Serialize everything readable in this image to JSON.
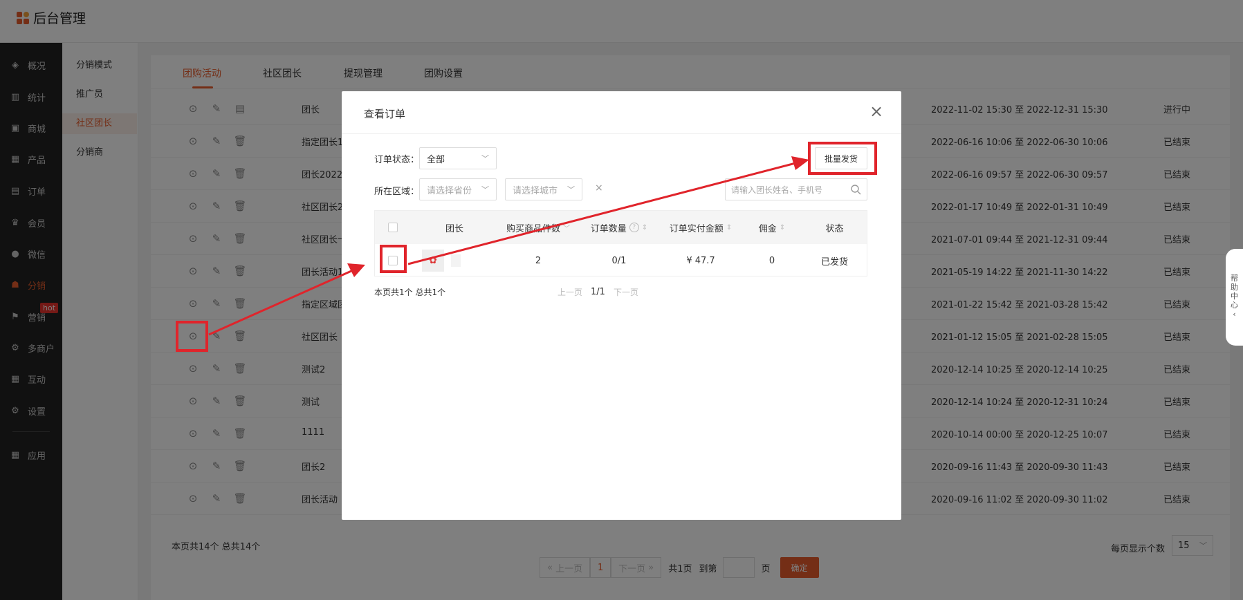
{
  "app": {
    "title": "后台管理"
  },
  "sidebar": {
    "items": [
      {
        "label": "概况",
        "icon": "layers-icon",
        "glyph": "◈"
      },
      {
        "label": "统计",
        "icon": "chart-icon",
        "glyph": "▥"
      },
      {
        "label": "商城",
        "icon": "shop-icon",
        "glyph": "▣"
      },
      {
        "label": "产品",
        "icon": "grid-icon",
        "glyph": "▦"
      },
      {
        "label": "订单",
        "icon": "order-icon",
        "glyph": "▤"
      },
      {
        "label": "会员",
        "icon": "crown-icon",
        "glyph": "♛"
      },
      {
        "label": "微信",
        "icon": "wechat-icon",
        "glyph": "●"
      },
      {
        "label": "分销",
        "icon": "users-icon",
        "glyph": "☗"
      },
      {
        "label": "营销",
        "icon": "flag-icon",
        "glyph": "⚑"
      },
      {
        "label": "多商户",
        "icon": "merchants-icon",
        "glyph": "⚙"
      },
      {
        "label": "互动",
        "icon": "interact-icon",
        "glyph": "▦"
      },
      {
        "label": "设置",
        "icon": "settings-icon",
        "glyph": "⚙"
      },
      {
        "label": "应用",
        "icon": "apps-icon",
        "glyph": "▦"
      }
    ],
    "hot_badge": "hot"
  },
  "subnav": {
    "items": [
      "分销模式",
      "推广员",
      "社区团长",
      "分销商"
    ]
  },
  "tabs": [
    "团购活动",
    "社区团长",
    "提现管理",
    "团购设置"
  ],
  "rows": [
    {
      "name": "团长",
      "time": "2022-11-02 15:30 至 2022-12-31 15:30",
      "status": "进行中"
    },
    {
      "name": "指定团长1",
      "time": "2022-06-16 10:06 至 2022-06-30 10:06",
      "status": "已结束"
    },
    {
      "name": "团长2022(",
      "time": "2022-06-16 09:57 至 2022-06-30 09:57",
      "status": "已结束"
    },
    {
      "name": "社区团长2",
      "time": "2022-01-17 10:49 至 2022-01-31 10:49",
      "status": "已结束"
    },
    {
      "name": "社区团长十",
      "time": "2021-07-01 09:44 至 2021-12-31 09:44",
      "status": "已结束"
    },
    {
      "name": "团长活动1",
      "time": "2021-05-19 14:22 至 2021-11-30 14:22",
      "status": "已结束"
    },
    {
      "name": "指定区域团",
      "time": "2021-01-22 15:42 至 2021-03-28 15:42",
      "status": "已结束"
    },
    {
      "name": "社区团长",
      "time": "2021-01-12 15:05 至 2021-02-28 15:05",
      "status": "已结束"
    },
    {
      "name": "测试2",
      "time": "2020-12-14 10:25 至 2020-12-14 10:25",
      "status": "已结束"
    },
    {
      "name": "测试",
      "time": "2020-12-14 10:24 至 2020-12-31 10:24",
      "status": "已结束"
    },
    {
      "name": "1111",
      "time": "2020-10-14 00:00 至 2020-12-25 10:07",
      "status": "已结束"
    },
    {
      "name": "团长2",
      "time": "2020-09-16 11:43 至 2020-09-30 11:43",
      "status": "已结束"
    },
    {
      "name": "团长活动",
      "time": "2020-09-16 11:02 至 2020-09-30 11:02",
      "status": "已结束"
    }
  ],
  "footer": {
    "page_info": "本页共14个  总共14个",
    "prev": "上一页",
    "current": "1",
    "next": "下一页",
    "total_pages": "共1页",
    "goto": "到第",
    "page_unit": "页",
    "confirm": "确定",
    "per_page_label": "每页显示个数",
    "per_page_value": "15"
  },
  "help": {
    "chars": [
      "帮",
      "助",
      "中",
      "心",
      "‹"
    ]
  },
  "modal": {
    "title": "查看订单",
    "close": "×",
    "status_label": "订单状态：",
    "status_value": "全部",
    "region_label": "所在区域：",
    "province_placeholder": "请选择省份",
    "city_placeholder": "请选择城市",
    "clear": "×",
    "search_placeholder": "请输入团长姓名、手机号",
    "batch_button": "批量发货",
    "columns": {
      "leader": "团长",
      "goods_count": "购买商品件数",
      "order_count": "订单数量",
      "paid_amount": "订单实付金额",
      "commission": "佣金",
      "status": "状态"
    },
    "row": {
      "goods_count": "2",
      "order_count": "0/1",
      "paid_amount": "¥ 47.7",
      "commission": "0",
      "status": "已发货"
    },
    "page_info": "本页共1个  总共1个",
    "prev": "上一页",
    "page": "1/1",
    "next": "下一页"
  }
}
